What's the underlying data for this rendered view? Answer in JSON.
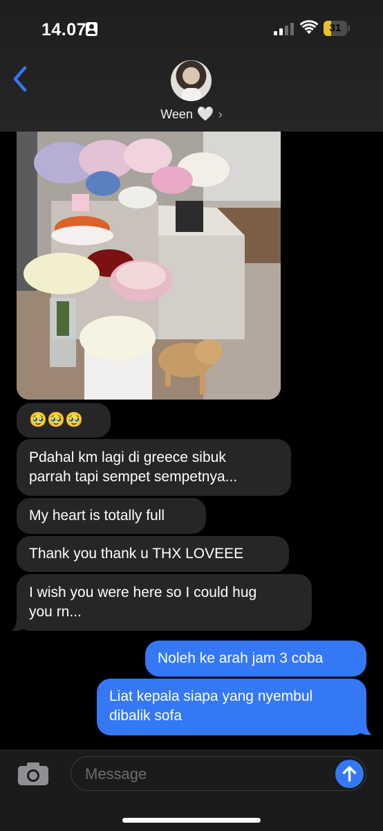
{
  "status_bar": {
    "time": "14.07",
    "battery": "31",
    "battery_level": 0.31
  },
  "header": {
    "contact_name": "Ween",
    "contact_emoji": "🤍",
    "chevron": "›"
  },
  "messages": [
    {
      "direction": "in",
      "type": "photo",
      "content": "photo of flower bouquets and a cat in a kitchen"
    },
    {
      "direction": "in",
      "type": "text",
      "lines": [
        "🥹🥹🥹"
      ]
    },
    {
      "direction": "in",
      "type": "text",
      "lines": [
        "Pdahal km lagi di greece sibuk",
        "parrah tapi sempet sempetnya..."
      ]
    },
    {
      "direction": "in",
      "type": "text",
      "lines": [
        "My heart is totally full"
      ]
    },
    {
      "direction": "in",
      "type": "text",
      "lines": [
        "Thank you thank u THX LOVEEE"
      ]
    },
    {
      "direction": "in",
      "type": "text",
      "lines": [
        "I wish you were here so I could hug",
        "you rn..."
      ]
    },
    {
      "direction": "out",
      "type": "text",
      "lines": [
        "Noleh ke arah jam 3 coba"
      ]
    },
    {
      "direction": "out",
      "type": "text",
      "lines": [
        "Liat kepala siapa yang nyembul",
        "dibalik sofa"
      ]
    }
  ],
  "input": {
    "placeholder": "Message"
  },
  "icons": {
    "back": "chevron-left-icon",
    "camera": "camera-icon",
    "send": "arrow-up-icon",
    "signal": "cellular-signal-icon",
    "wifi": "wifi-icon",
    "battery": "battery-icon",
    "focus": "id-card-icon"
  },
  "colors": {
    "accent": "#3478f6",
    "incoming_bubble": "#262629",
    "battery_fill": "#e8c22b"
  }
}
